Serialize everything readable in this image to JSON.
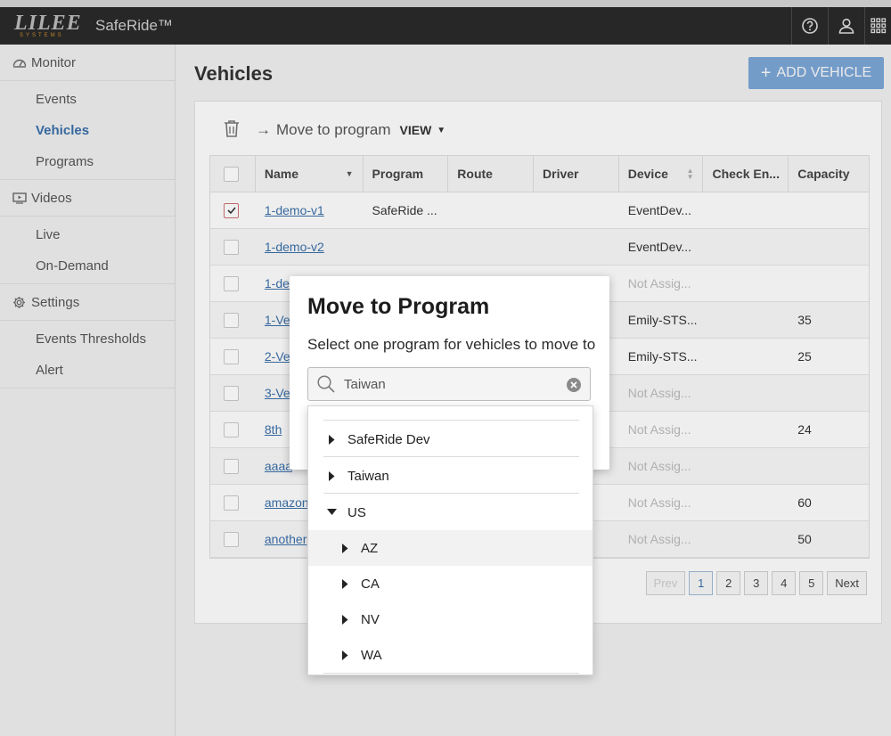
{
  "header": {
    "logo_text": "LILEE",
    "logo_subtext": "SYSTEMS",
    "app_name": "SafeRide™",
    "icons": [
      "help-icon",
      "user-icon",
      "apps-grid-icon"
    ]
  },
  "sidebar": {
    "sections": [
      {
        "label": "Monitor",
        "icon": "dashboard-gauge-icon",
        "items": [
          {
            "label": "Events",
            "active": false
          },
          {
            "label": "Vehicles",
            "active": true
          },
          {
            "label": "Programs",
            "active": false
          }
        ]
      },
      {
        "label": "Videos",
        "icon": "video-icon",
        "items": [
          {
            "label": "Live",
            "active": false
          },
          {
            "label": "On-Demand",
            "active": false
          }
        ]
      },
      {
        "label": "Settings",
        "icon": "gear-icon",
        "items": [
          {
            "label": "Events Thresholds",
            "active": false
          },
          {
            "label": "Alert",
            "active": false
          }
        ]
      }
    ]
  },
  "page": {
    "title": "Vehicles",
    "add_button": "ADD VEHICLE",
    "toolbar": {
      "move_label": "Move to program",
      "view_label": "VIEW"
    }
  },
  "table": {
    "columns": [
      "Name",
      "Program",
      "Route",
      "Driver",
      "Device",
      "Check En...",
      "Capacity"
    ],
    "rows": [
      {
        "checked": true,
        "name": "1-demo-v1",
        "program": "SafeRide ...",
        "route": "",
        "driver": "",
        "device": "EventDev...",
        "device_muted": false,
        "check": "",
        "capacity": ""
      },
      {
        "checked": false,
        "name": "1-demo-v2",
        "program": "",
        "route": "",
        "driver": "",
        "device": "EventDev...",
        "device_muted": false,
        "check": "",
        "capacity": ""
      },
      {
        "checked": false,
        "name": "1-de",
        "program": "",
        "route": "",
        "driver": "",
        "device": "Not Assig...",
        "device_muted": true,
        "check": "",
        "capacity": ""
      },
      {
        "checked": false,
        "name": "1-Ve",
        "program": "",
        "route": "",
        "driver": "",
        "device": "Emily-STS...",
        "device_muted": false,
        "check": "",
        "capacity": "35"
      },
      {
        "checked": false,
        "name": "2-Ve",
        "program": "",
        "route": "",
        "driver": "",
        "device": "Emily-STS...",
        "device_muted": false,
        "check": "",
        "capacity": "25"
      },
      {
        "checked": false,
        "name": "3-Ve",
        "program": "",
        "route": "",
        "driver": "",
        "device": "Not Assig...",
        "device_muted": true,
        "check": "",
        "capacity": ""
      },
      {
        "checked": false,
        "name": "8th",
        "program": "",
        "route": "",
        "driver": "",
        "device": "Not Assig...",
        "device_muted": true,
        "check": "",
        "capacity": "24"
      },
      {
        "checked": false,
        "name": "aaaa",
        "program": "",
        "route": "",
        "driver": "",
        "device": "Not Assig...",
        "device_muted": true,
        "check": "",
        "capacity": ""
      },
      {
        "checked": false,
        "name": "amazon",
        "program": "",
        "route": "",
        "driver": "",
        "device": "Not Assig...",
        "device_muted": true,
        "check": "",
        "capacity": "60"
      },
      {
        "checked": false,
        "name": "another",
        "program": "",
        "route": "",
        "driver": "",
        "device": "Not Assig...",
        "device_muted": true,
        "check": "",
        "capacity": "50"
      }
    ]
  },
  "pagination": {
    "prev": "Prev",
    "pages": [
      "1",
      "2",
      "3",
      "4",
      "5"
    ],
    "current": "1",
    "next": "Next"
  },
  "modal": {
    "title": "Move to Program",
    "subtitle": "Select one program for vehicles to move to",
    "search_value": "Taiwan"
  },
  "dropdown": {
    "items": [
      {
        "label": "SafeRide Dev",
        "expanded": false,
        "level": 0,
        "highlight": false
      },
      {
        "label": "Taiwan",
        "expanded": false,
        "level": 0,
        "highlight": false
      },
      {
        "label": "US",
        "expanded": true,
        "level": 0,
        "highlight": false
      },
      {
        "label": "AZ",
        "expanded": false,
        "level": 1,
        "highlight": true
      },
      {
        "label": "CA",
        "expanded": false,
        "level": 1,
        "highlight": false
      },
      {
        "label": "NV",
        "expanded": false,
        "level": 1,
        "highlight": false
      },
      {
        "label": "WA",
        "expanded": false,
        "level": 1,
        "highlight": false
      }
    ]
  },
  "colors": {
    "accent": "#3a6fa8",
    "button": "#4a87cc",
    "topbar": "#2a2a2a"
  }
}
